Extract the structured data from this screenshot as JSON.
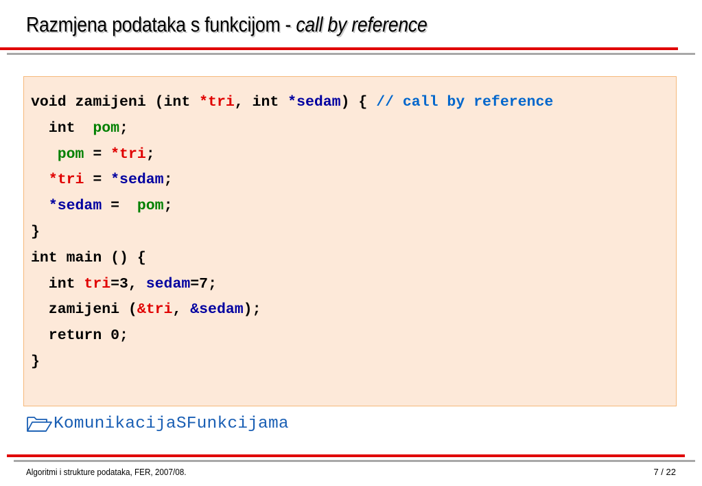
{
  "slide": {
    "title_main": "Razmjena podataka s funkcijom - ",
    "title_italic": "call by reference"
  },
  "code": {
    "l1_a": "void zamijeni (int ",
    "l1_b": "*tri",
    "l1_c": ", int ",
    "l1_d": "*sedam",
    "l1_e": ") { ",
    "l1_f": "// call by reference",
    "l2_a": "  int  ",
    "l2_b": "pom",
    "l2_c": ";",
    "l3_a": "   ",
    "l3_b": "pom",
    "l3_c": " = ",
    "l3_d": "*tri",
    "l3_e": ";",
    "l4_a": "  ",
    "l4_b": "*tri",
    "l4_c": " = ",
    "l4_d": "*sedam",
    "l4_e": ";",
    "l5_a": "  ",
    "l5_b": "*sedam",
    "l5_c": " =  ",
    "l5_d": "pom",
    "l5_e": ";",
    "l6": "}",
    "l7": "int main () {",
    "l8_a": "  int ",
    "l8_b": "tri",
    "l8_c": "=3, ",
    "l8_d": "sedam",
    "l8_e": "=7;",
    "l9_a": "  zamijeni (",
    "l9_b": "&tri",
    "l9_c": ", ",
    "l9_d": "&sedam",
    "l9_e": ");",
    "l10": "  return 0;",
    "l11": "}"
  },
  "link": {
    "icon": "folder-icon",
    "label": "KomunikacijaSFunkcijama"
  },
  "footer": {
    "left": "Algoritmi i strukture podataka, FER, 2007/08.",
    "page": "7 / 22"
  },
  "colors": {
    "accent_red": "#e00000",
    "code_bg": "#fde9d9",
    "code_border": "#f5b87a",
    "pointer_red": "#e00000",
    "pointer_blue": "#0000a0",
    "variable_green": "#008000",
    "comment_blue": "#0066cc",
    "link_blue": "#1a5fb4"
  }
}
